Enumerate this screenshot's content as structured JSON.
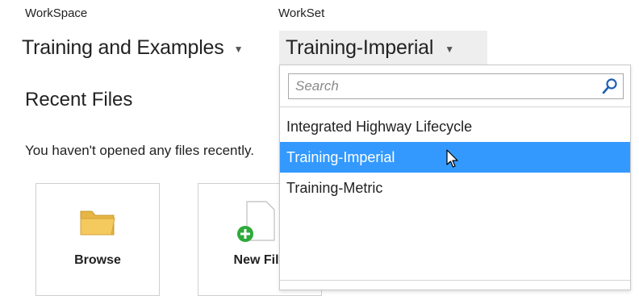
{
  "workspace": {
    "label": "WorkSpace",
    "value": "Training and Examples"
  },
  "workset": {
    "label": "WorkSet",
    "value": "Training-Imperial"
  },
  "recent_files": {
    "title": "Recent Files",
    "empty_message": "You haven't opened any files recently."
  },
  "tiles": [
    {
      "label": "Browse",
      "icon": "folder-icon"
    },
    {
      "label": "New File",
      "icon": "new-file-icon"
    }
  ],
  "dropdown": {
    "search_placeholder": "Search",
    "options": [
      {
        "label": "Integrated Highway Lifecycle",
        "selected": false
      },
      {
        "label": "Training-Imperial",
        "selected": true
      },
      {
        "label": "Training-Metric",
        "selected": false
      }
    ]
  },
  "colors": {
    "selected_option_bg": "#3399ff",
    "folder": "#f4c95d",
    "add_badge": "#2eaa3a"
  }
}
